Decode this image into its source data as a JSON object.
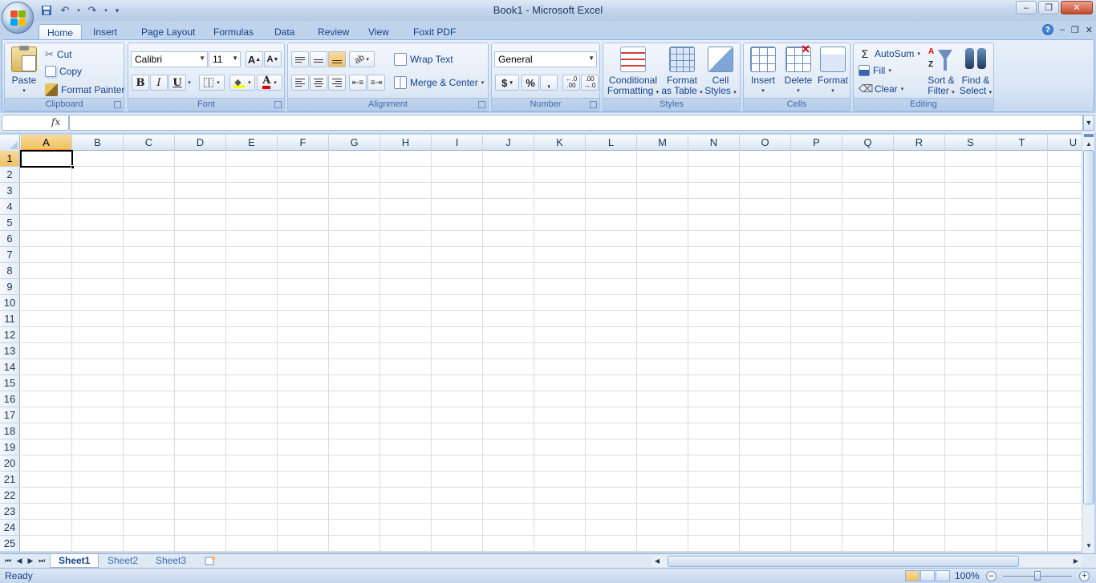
{
  "window": {
    "title": "Book1 - Microsoft Excel"
  },
  "tabs": [
    "Home",
    "Insert",
    "Page Layout",
    "Formulas",
    "Data",
    "Review",
    "View",
    "Foxit PDF"
  ],
  "active_tab": "Home",
  "ribbon": {
    "clipboard": {
      "label": "Clipboard",
      "paste": "Paste",
      "cut": "Cut",
      "copy": "Copy",
      "format_painter": "Format Painter"
    },
    "font": {
      "label": "Font",
      "font_name": "Calibri",
      "font_size": "11",
      "bold": "B",
      "italic": "I",
      "underline": "U"
    },
    "alignment": {
      "label": "Alignment",
      "wrap_text": "Wrap Text",
      "merge_center": "Merge & Center"
    },
    "number": {
      "label": "Number",
      "format": "General",
      "currency": "$",
      "percent": "%",
      "comma": ",",
      "inc_decimal": "+.0 .00",
      "dec_decimal": ".00 →.0"
    },
    "styles": {
      "label": "Styles",
      "conditional_formatting_1": "Conditional",
      "conditional_formatting_2": "Formatting",
      "format_as_table_1": "Format",
      "format_as_table_2": "as Table",
      "cell_styles_1": "Cell",
      "cell_styles_2": "Styles"
    },
    "cells": {
      "label": "Cells",
      "insert": "Insert",
      "delete": "Delete",
      "format": "Format"
    },
    "editing": {
      "label": "Editing",
      "autosum": "AutoSum",
      "fill": "Fill",
      "clear": "Clear",
      "sort_filter_1": "Sort &",
      "sort_filter_2": "Filter",
      "find_select_1": "Find &",
      "find_select_2": "Select"
    }
  },
  "formula_bar": {
    "name_box": "",
    "fx": "fx",
    "formula": ""
  },
  "grid": {
    "columns": [
      "A",
      "B",
      "C",
      "D",
      "E",
      "F",
      "G",
      "H",
      "I",
      "J",
      "K",
      "L",
      "M",
      "N",
      "O",
      "P",
      "Q",
      "R",
      "S",
      "T",
      "U"
    ],
    "rows": [
      "1",
      "2",
      "3",
      "4",
      "5",
      "6",
      "7",
      "8",
      "9",
      "10",
      "11",
      "12",
      "13",
      "14",
      "15",
      "16",
      "17",
      "18",
      "19",
      "20",
      "21",
      "22",
      "23",
      "24",
      "25"
    ],
    "active_cell": "A1"
  },
  "sheets": [
    "Sheet1",
    "Sheet2",
    "Sheet3"
  ],
  "active_sheet": "Sheet1",
  "status": {
    "ready": "Ready",
    "zoom": "100%"
  },
  "colors": {
    "accent": "#15428b",
    "ribbon_bg": "#dbe7f6",
    "selection": "#f1c15f"
  }
}
